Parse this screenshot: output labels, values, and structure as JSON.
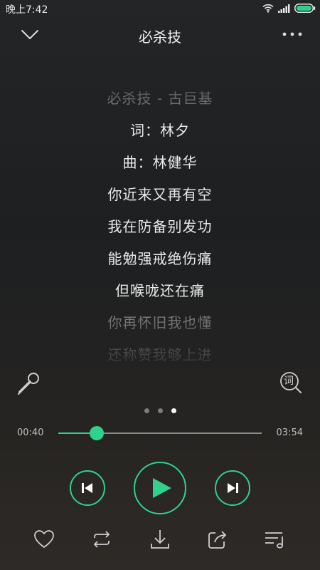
{
  "status_bar": {
    "time": "晚上7:42",
    "icons": [
      "wifi-icon",
      "signal-icon",
      "battery-icon"
    ]
  },
  "header": {
    "title": "必杀技",
    "back_icon": "chevron-down-icon",
    "more_icon": "more-dots-icon"
  },
  "lyrics": {
    "lines": [
      "必杀技 - 古巨基",
      "词：林夕",
      "曲：林健华",
      "你近来又再有空",
      "我在防备别发功",
      "能勉强戒绝伤痛",
      "但喉咙还在痛",
      "你再怀旧我也懂",
      "还称赞我够上进"
    ]
  },
  "side_buttons": {
    "mic_icon": "microphone-icon",
    "lyric_icon": "lyrics-search-icon",
    "lyric_icon_text": "词"
  },
  "pager": {
    "count": 3,
    "active": 3
  },
  "progress": {
    "current": "00:40",
    "total": "03:54",
    "fraction": 0.19
  },
  "controls": {
    "prev_icon": "previous-track-icon",
    "play_icon": "play-icon",
    "next_icon": "next-track-icon"
  },
  "bottom_bar": {
    "items": [
      "heart-icon",
      "repeat-icon",
      "download-icon",
      "share-icon",
      "playlist-icon"
    ]
  },
  "colors": {
    "accent": "#2fd18b",
    "text": "#eaeaea",
    "dim_text": "#8c8c8c"
  }
}
